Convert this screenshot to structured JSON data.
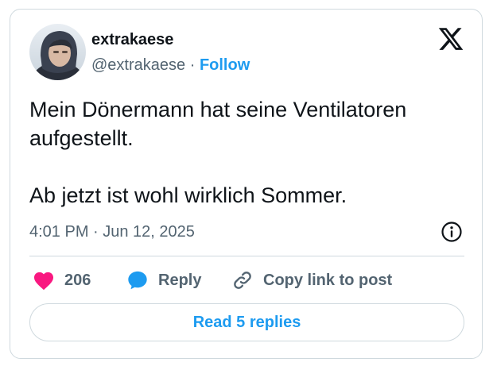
{
  "author": {
    "display_name": "extrakaese",
    "handle": "@extrakaese",
    "separator": "·",
    "follow_label": "Follow"
  },
  "tweet": {
    "line1": "Mein Dönermann hat seine Ventilatoren aufgestellt.",
    "line2": "Ab jetzt ist wohl wirklich Sommer."
  },
  "timestamp": "4:01 PM · Jun 12, 2025",
  "actions": {
    "like_count": "206",
    "reply_label": "Reply",
    "copy_link_label": "Copy link to post"
  },
  "read_replies_label": "Read 5 replies",
  "icons": {
    "logo": "x-logo-icon",
    "info": "info-icon",
    "like": "heart-icon",
    "reply": "speech-bubble-icon",
    "copy": "link-icon"
  },
  "colors": {
    "accent": "#1d9bf0",
    "heart": "#f91880",
    "text": "#0f1419",
    "secondary": "#536471",
    "border": "#cfd9de"
  }
}
